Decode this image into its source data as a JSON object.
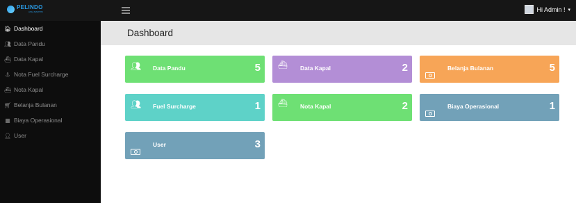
{
  "brand": {
    "name": "PELINDO",
    "subtitle": "JASA MARITIM"
  },
  "topbar": {
    "user_greeting": "Hi Admin !",
    "caret": "▾"
  },
  "sidebar": {
    "items": [
      {
        "label": "Dashboard",
        "icon": "home-icon",
        "active": true
      },
      {
        "label": "Data Pandu",
        "icon": "users-icon"
      },
      {
        "label": "Data Kapal",
        "icon": "ship-icon"
      },
      {
        "label": "Nota Fuel Surcharge",
        "icon": "anchor-icon"
      },
      {
        "label": "Nota Kapal",
        "icon": "ship-icon"
      },
      {
        "label": "Belanja Bulanan",
        "icon": "cart-icon"
      },
      {
        "label": "Biaya Operasional",
        "icon": "calculator-icon"
      },
      {
        "label": "User",
        "icon": "user-icon"
      }
    ]
  },
  "main": {
    "title": "Dashboard",
    "cards": [
      {
        "label": "Data Pandu",
        "count": "5",
        "color": "#6ee074",
        "icon": "users-icon"
      },
      {
        "label": "Data Kapal",
        "count": "2",
        "color": "#b38ed6",
        "icon": "ship-icon"
      },
      {
        "label": "Belanja Bulanan",
        "count": "5",
        "color": "#f7a557",
        "icon": "money-icon"
      },
      {
        "label": "Fuel Surcharge",
        "count": "1",
        "color": "#5ed2c8",
        "icon": "users-icon"
      },
      {
        "label": "Nota Kapal",
        "count": "2",
        "color": "#6ee074",
        "icon": "ship-icon"
      },
      {
        "label": "Biaya Operasional",
        "count": "1",
        "color": "#72a1b8",
        "icon": "money-icon"
      },
      {
        "label": "User",
        "count": "3",
        "color": "#72a1b8",
        "icon": "money-icon"
      }
    ]
  }
}
